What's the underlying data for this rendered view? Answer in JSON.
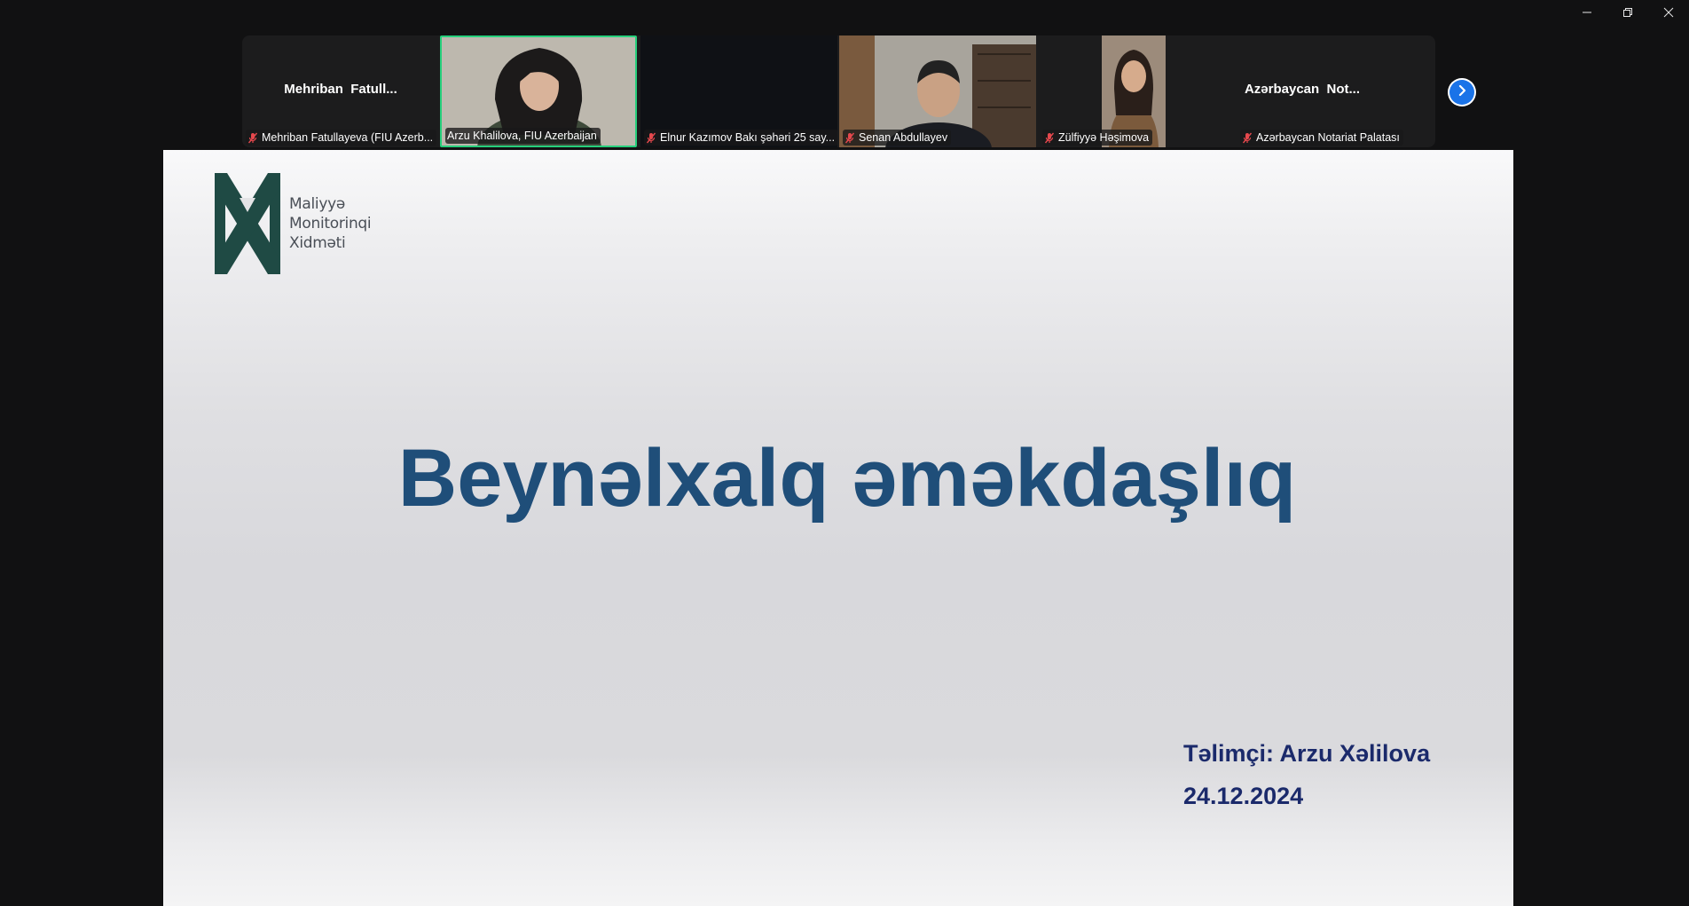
{
  "window": {
    "controls": [
      "minimize-icon",
      "restore-icon",
      "close-icon"
    ]
  },
  "participants": [
    {
      "display_name": "Mehriban  Fatull...",
      "tag": "Mehriban Fatullayeva (FIU Azerb...",
      "muted": true,
      "video": false
    },
    {
      "tag": "Arzu Khalilova, FIU Azerbaijan",
      "muted": false,
      "video": true,
      "active_speaker": true
    },
    {
      "tag": "Elnur Kazımov Bakı şəhəri 25 say...",
      "muted": true,
      "video": true
    },
    {
      "tag": "Senan Abdullayev",
      "muted": true,
      "video": true
    },
    {
      "tag": "Zülfiyyə Həşimova",
      "muted": true,
      "video": true
    },
    {
      "display_name": "Azərbaycan  Not...",
      "tag": "Azərbaycan Notariat Palatası",
      "muted": true,
      "video": false
    }
  ],
  "strip": {
    "next_icon": "chevron-right-icon"
  },
  "slide": {
    "logo": {
      "line1": "Maliyyə",
      "line2": "Monitorinqi",
      "line3": "Xidməti"
    },
    "title": "Beynəlxalq əməkdaşlıq",
    "trainer": "Təlimçi: Arzu Xəlilova",
    "date": "24.12.2024"
  },
  "colors": {
    "active_speaker_border": "#26d07c",
    "muted_mic": "#e5484d",
    "slide_title": "#1f4e79",
    "slide_trainer": "#1b2a6b",
    "next_button": "#1a73e8"
  }
}
